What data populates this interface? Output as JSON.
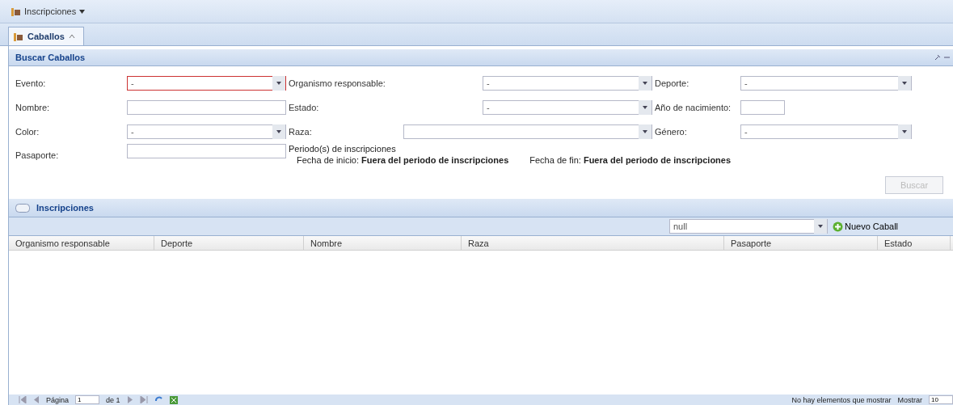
{
  "menu": {
    "label": "Inscripciones"
  },
  "tabs": [
    {
      "label": "Caballos",
      "selected": true
    }
  ],
  "search_panel": {
    "title": "Buscar Caballos",
    "rows": [
      [
        {
          "label": "Evento:",
          "kind": "combo",
          "value": "-",
          "invalid": true
        },
        {
          "label": "Organismo responsable:",
          "kind": "combo",
          "value": "-",
          "invalid": false
        },
        {
          "label": "Deporte:",
          "kind": "combo",
          "value": "-",
          "invalid": false
        }
      ],
      [
        {
          "label": "Nombre:",
          "kind": "text",
          "invalid": false
        },
        {
          "label": "Estado:",
          "kind": "combo",
          "value": "-",
          "invalid": false
        },
        {
          "label": "Año de nacimiento:",
          "kind": "short",
          "invalid": false
        }
      ],
      [
        {
          "label": "Color:",
          "kind": "combo",
          "value": "-",
          "invalid": false
        },
        {
          "label": "Raza:",
          "kind": "combo",
          "invalid": false
        },
        {
          "label": "Género:",
          "kind": "combo",
          "value": "-",
          "invalid": false
        }
      ]
    ],
    "passport": {
      "label": "Pasaporte:"
    },
    "period": {
      "title": "Periodo(s) de inscripciones",
      "start": "Fecha de inicio: **Fuera del periodo de inscripciones**",
      "end": "Fecha de fin: **Fuera del periodo de inscripciones**"
    },
    "button": {
      "label": "Buscar",
      "disabled": true
    }
  },
  "grid_panel": {
    "title": "Inscripciones",
    "filter": {
      "value": "null"
    },
    "new_button": "Nuevo Caball",
    "columns": [
      "Organismo responsable",
      "Deporte",
      "Nombre",
      "Raza",
      "Pasaporte",
      "Estado"
    ]
  },
  "paging": {
    "page_label": "Página",
    "page": "1",
    "of": "de 1",
    "empty": "No hay elementos que mostrar",
    "show": "Mostrar",
    "size": "10"
  }
}
